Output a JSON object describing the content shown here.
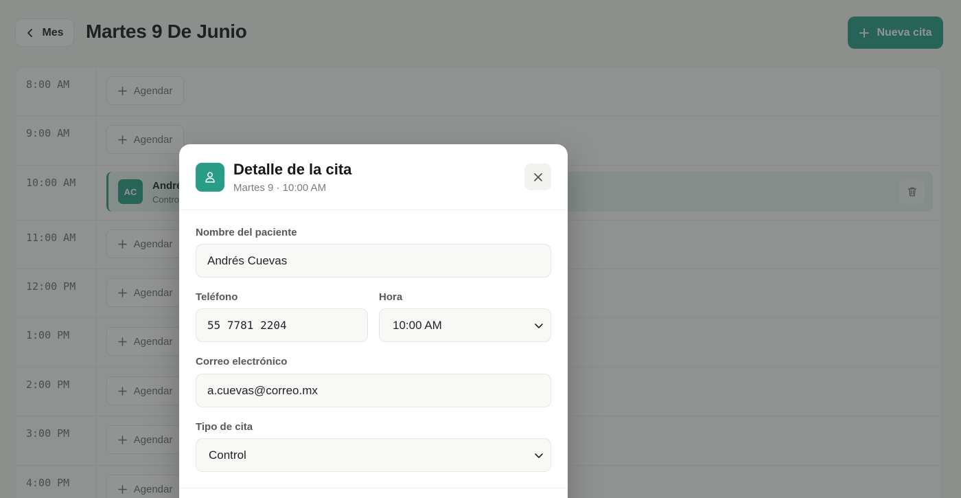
{
  "header": {
    "back_label": "Mes",
    "title": "Martes 9 De Junio",
    "new_button_label": "Nueva cita"
  },
  "schedule": {
    "agendar_label": "Agendar",
    "slots": [
      {
        "time": "8:00 AM"
      },
      {
        "time": "9:00 AM"
      },
      {
        "time": "10:00 AM",
        "appointment": {
          "initials": "AC",
          "name": "Andrés Cuevas",
          "type": "Control"
        }
      },
      {
        "time": "11:00 AM"
      },
      {
        "time": "12:00 PM"
      },
      {
        "time": "1:00 PM"
      },
      {
        "time": "2:00 PM"
      },
      {
        "time": "3:00 PM"
      },
      {
        "time": "4:00 PM"
      }
    ]
  },
  "modal": {
    "title": "Detalle de la cita",
    "subtitle": "Martes 9 · 10:00 AM",
    "fields": {
      "name": {
        "label": "Nombre del paciente",
        "value": "Andrés Cuevas"
      },
      "phone": {
        "label": "Teléfono",
        "value": "55 7781 2204"
      },
      "time": {
        "label": "Hora",
        "value": "10:00 AM"
      },
      "email": {
        "label": "Correo electrónico",
        "value": "a.cuevas@correo.mx"
      },
      "type": {
        "label": "Tipo de cita",
        "value": "Control"
      }
    }
  },
  "colors": {
    "accent": "#2a9d86",
    "appointment_bg": "#e3f1ec"
  }
}
